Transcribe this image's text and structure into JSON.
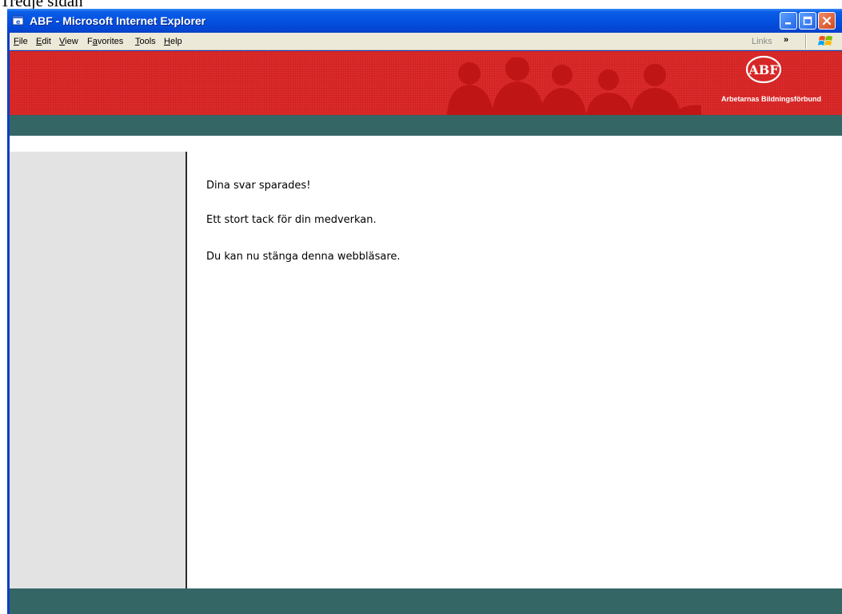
{
  "caption": "Tredje sidan",
  "window": {
    "title": "ABF - Microsoft Internet Explorer"
  },
  "menu": {
    "items": [
      {
        "pre": "",
        "key": "F",
        "post": "ile"
      },
      {
        "pre": "",
        "key": "E",
        "post": "dit"
      },
      {
        "pre": "",
        "key": "V",
        "post": "iew"
      },
      {
        "pre": "F",
        "key": "a",
        "post": "vorites"
      },
      {
        "pre": "",
        "key": "T",
        "post": "ools"
      },
      {
        "pre": "",
        "key": "H",
        "post": "elp"
      }
    ],
    "links_label": "Links",
    "chevron": "»"
  },
  "banner": {
    "logo_text": "ABF",
    "subtitle": "Arbetarnas Bildningsförbund"
  },
  "content": {
    "lines": [
      "Dina svar sparades!",
      "Ett stort tack för din medverkan.",
      "Du kan nu stänga denna webbläsare."
    ]
  },
  "colors": {
    "banner_red": "#dd2a2a",
    "band_green": "#356666",
    "sidebar_gray": "#e3e3e3",
    "titlebar_blue": "#0551e0"
  },
  "icons": [
    "ie-icon",
    "minimize-icon",
    "maximize-icon",
    "close-icon",
    "windows-logo-icon",
    "abf-logo-icon"
  ]
}
